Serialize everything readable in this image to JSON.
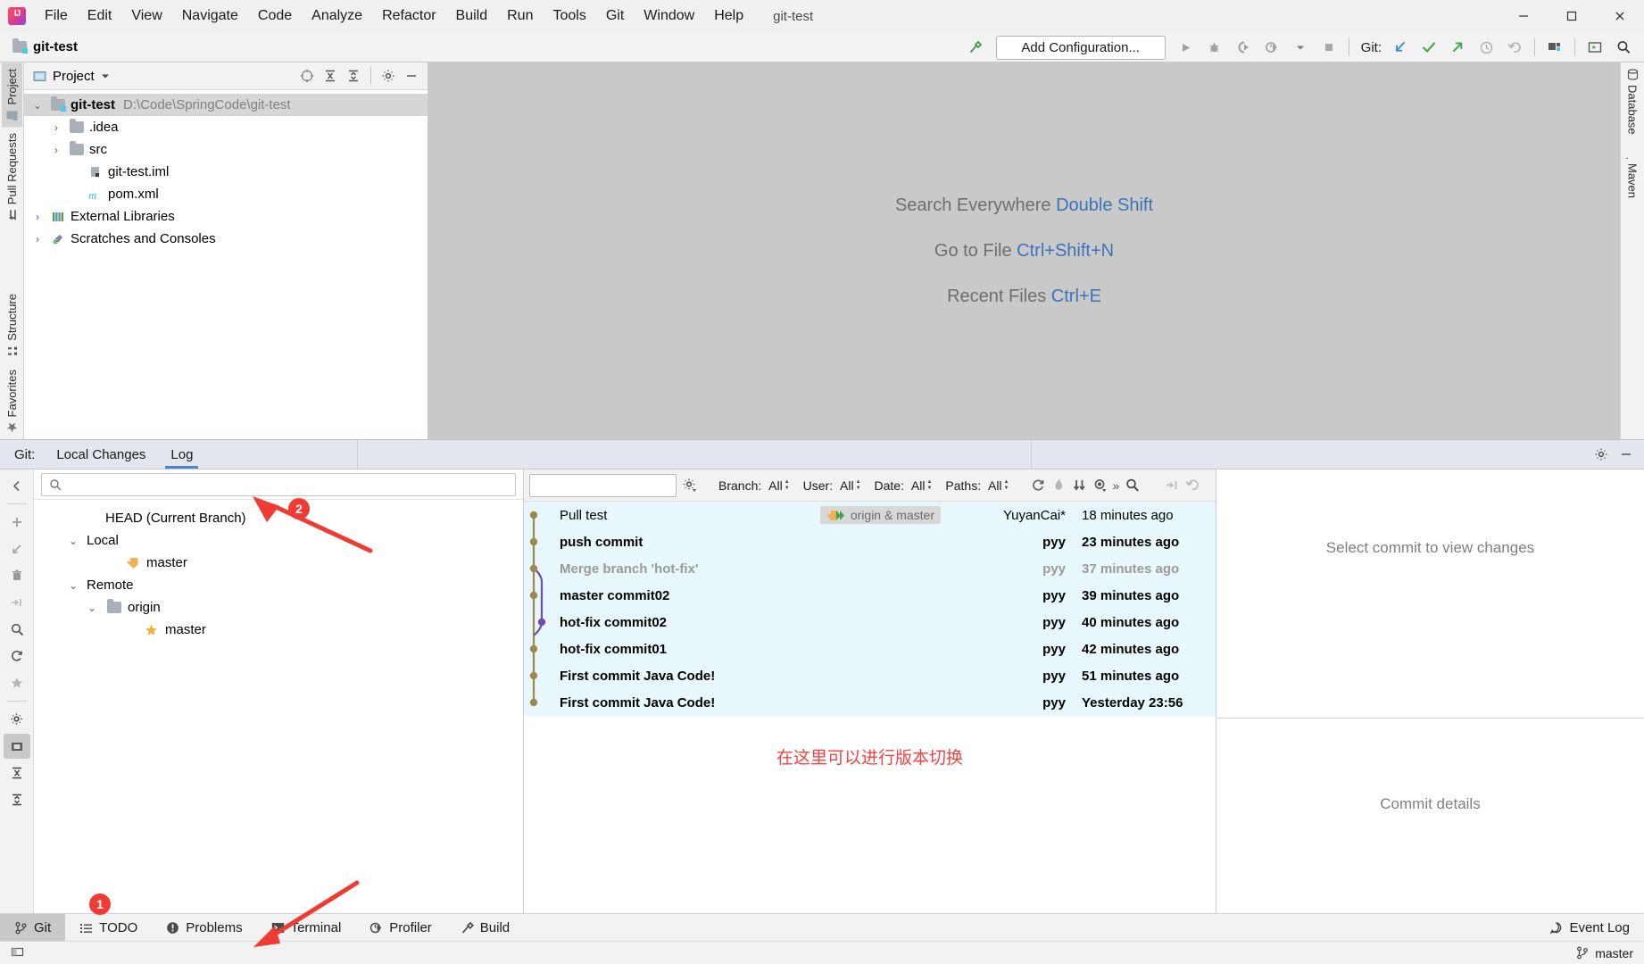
{
  "window": {
    "title": "git-test",
    "minimize_label": "–",
    "maximize_label": "❐",
    "close_label": "✕"
  },
  "menu": {
    "items": [
      {
        "label": "File",
        "mnemonic": "F"
      },
      {
        "label": "Edit",
        "mnemonic": "E"
      },
      {
        "label": "View",
        "mnemonic": "V"
      },
      {
        "label": "Navigate",
        "mnemonic": "N"
      },
      {
        "label": "Code",
        "mnemonic": "C"
      },
      {
        "label": "Analyze",
        "mnemonic": "z"
      },
      {
        "label": "Refactor",
        "mnemonic": "R"
      },
      {
        "label": "Build",
        "mnemonic": "B"
      },
      {
        "label": "Run",
        "mnemonic": "u"
      },
      {
        "label": "Tools",
        "mnemonic": "T"
      },
      {
        "label": "Git",
        "mnemonic": ""
      },
      {
        "label": "Window",
        "mnemonic": "W"
      },
      {
        "label": "Help",
        "mnemonic": "H"
      }
    ]
  },
  "navbar": {
    "breadcrumb": "git-test",
    "add_configuration": "Add Configuration...",
    "git_label": "Git:"
  },
  "left_stripe": {
    "items": [
      {
        "label": "Project",
        "icon": "project-icon",
        "active": true
      },
      {
        "label": "Pull Requests",
        "icon": "pull-request-icon",
        "active": false
      },
      {
        "label": "Structure",
        "icon": "structure-icon",
        "active": false
      },
      {
        "label": "Favorites",
        "icon": "star-icon",
        "active": false
      }
    ]
  },
  "right_stripe": {
    "items": [
      {
        "label": "Database",
        "icon": "database-icon"
      },
      {
        "label": "Maven",
        "icon": "maven-icon"
      }
    ]
  },
  "project_window": {
    "title": "Project",
    "tree": [
      {
        "label": "git-test",
        "secondary": "D:\\Code\\SpringCode\\git-test",
        "indent": 0,
        "chevron": "⌄",
        "icon": "module-folder-icon",
        "bold": true,
        "selected": true
      },
      {
        "label": ".idea",
        "secondary": "",
        "indent": 1,
        "chevron": "›",
        "icon": "folder-icon",
        "bold": false,
        "selected": false
      },
      {
        "label": "src",
        "secondary": "",
        "indent": 1,
        "chevron": "›",
        "icon": "folder-icon",
        "bold": false,
        "selected": false
      },
      {
        "label": "git-test.iml",
        "secondary": "",
        "indent": 2,
        "chevron": "",
        "icon": "iml-file-icon",
        "bold": false,
        "selected": false
      },
      {
        "label": "pom.xml",
        "secondary": "",
        "indent": 2,
        "chevron": "",
        "icon": "maven-pom-icon",
        "bold": false,
        "selected": false
      },
      {
        "label": "External Libraries",
        "secondary": "",
        "indent": 0,
        "chevron": "›",
        "icon": "libraries-icon",
        "bold": false,
        "selected": false
      },
      {
        "label": "Scratches and Consoles",
        "secondary": "",
        "indent": 0,
        "chevron": "›",
        "icon": "scratches-icon",
        "bold": false,
        "selected": false
      }
    ]
  },
  "editor": {
    "hints": [
      {
        "action": "Search Everywhere",
        "shortcut": "Double Shift"
      },
      {
        "action": "Go to File",
        "shortcut": "Ctrl+Shift+N"
      },
      {
        "action": "Recent Files",
        "shortcut": "Ctrl+E"
      }
    ]
  },
  "git_window": {
    "prefix_label": "Git:",
    "tabs": [
      {
        "label": "Local Changes",
        "active": false
      },
      {
        "label": "Log",
        "active": true
      }
    ],
    "branch_search_placeholder": "",
    "branch_tree": [
      {
        "label": "HEAD (Current Branch)",
        "indent": 2,
        "chevron": "",
        "icon": ""
      },
      {
        "label": "Local",
        "indent": 1,
        "chevron": "⌄",
        "icon": ""
      },
      {
        "label": "master",
        "indent": 3,
        "chevron": "",
        "icon": "branch-tag-icon"
      },
      {
        "label": "Remote",
        "indent": 1,
        "chevron": "⌄",
        "icon": ""
      },
      {
        "label": "origin",
        "indent": 2,
        "chevron": "⌄",
        "icon": "folder-icon"
      },
      {
        "label": "master",
        "indent": 4,
        "chevron": "",
        "icon": "star-icon"
      }
    ],
    "log_toolbar": {
      "search_placeholder": "",
      "filters": [
        {
          "name": "Branch",
          "value": "All"
        },
        {
          "name": "User",
          "value": "All"
        },
        {
          "name": "Date",
          "value": "All"
        },
        {
          "name": "Paths",
          "value": "All"
        }
      ],
      "actions": [
        {
          "name": "refresh-icon"
        },
        {
          "name": "highlight-icon"
        },
        {
          "name": "sort-icon"
        },
        {
          "name": "eye-icon"
        },
        {
          "name": "more-icon"
        },
        {
          "name": "search-icon"
        }
      ],
      "right_actions": [
        {
          "name": "collapse-to-icon"
        },
        {
          "name": "undo-icon"
        },
        {
          "name": "grid-icon"
        },
        {
          "name": "filter-icon"
        },
        {
          "name": "layout-icon"
        }
      ]
    },
    "commits": [
      {
        "subject": "Pull test",
        "ref": "origin & master",
        "author": "YuyanCai*",
        "date": "18 minutes ago",
        "style": "plain",
        "node": "brown",
        "merge_from": false
      },
      {
        "subject": "push commit",
        "ref": "",
        "author": "pyy",
        "date": "23 minutes ago",
        "style": "bold",
        "node": "brown",
        "merge_from": false
      },
      {
        "subject": "Merge branch 'hot-fix'",
        "ref": "",
        "author": "pyy",
        "date": "37 minutes ago",
        "style": "muted",
        "node": "brown",
        "merge_from": true
      },
      {
        "subject": "master commit02",
        "ref": "",
        "author": "pyy",
        "date": "39 minutes ago",
        "style": "bold",
        "node": "brown",
        "merge_from": false
      },
      {
        "subject": "hot-fix commit02",
        "ref": "",
        "author": "pyy",
        "date": "40 minutes ago",
        "style": "bold",
        "node": "purple",
        "merge_from": false
      },
      {
        "subject": "hot-fix commit01",
        "ref": "",
        "author": "pyy",
        "date": "42 minutes ago",
        "style": "bold",
        "node": "brown",
        "merge_from": false
      },
      {
        "subject": "First commit Java Code!",
        "ref": "",
        "author": "pyy",
        "date": "51 minutes ago",
        "style": "bold",
        "node": "brown",
        "merge_from": false
      },
      {
        "subject": "First commit Java Code!",
        "ref": "",
        "author": "pyy",
        "date": "Yesterday 23:56",
        "style": "bold",
        "node": "brown",
        "merge_from": false
      }
    ],
    "annotation_cn": "在这里可以进行版本切换",
    "details": {
      "changes_placeholder": "Select commit to view changes",
      "commit_placeholder": "Commit details"
    },
    "vtoolbar": [
      {
        "name": "add-icon"
      },
      {
        "name": "checkout-icon"
      },
      {
        "name": "delete-icon"
      },
      {
        "name": "collapse-icon"
      },
      {
        "name": "search-icon"
      },
      {
        "name": "refresh-icon"
      },
      {
        "name": "favorite-star-icon"
      },
      {
        "name": "settings-gear-icon"
      },
      {
        "name": "show-folders-icon"
      },
      {
        "name": "expand-all-icon"
      },
      {
        "name": "collapse-all-icon"
      }
    ]
  },
  "bottom_bar": {
    "items": [
      {
        "label": "Git",
        "icon": "git-branch-icon",
        "active": true
      },
      {
        "label": "TODO",
        "icon": "todo-list-icon",
        "active": false
      },
      {
        "label": "Problems",
        "icon": "problems-icon",
        "active": false
      },
      {
        "label": "Terminal",
        "icon": "terminal-icon",
        "active": false
      },
      {
        "label": "Profiler",
        "icon": "profiler-icon",
        "active": false
      },
      {
        "label": "Build",
        "icon": "build-hammer-icon",
        "active": false
      }
    ],
    "event_log": "Event Log"
  },
  "status_bar": {
    "branch": "master"
  },
  "annotations": [
    {
      "number": "1",
      "target": "git-bottom-tab"
    },
    {
      "number": "2",
      "target": "log-tab"
    }
  ],
  "colors": {
    "accent_blue": "#4a86c8",
    "commit_row_bg": "#e8f7fb",
    "annotation_red": "#ef3b34",
    "graph_brown": "#9d8a4e",
    "graph_purple": "#6b4fa8",
    "link_blue": "#3b74b6"
  }
}
